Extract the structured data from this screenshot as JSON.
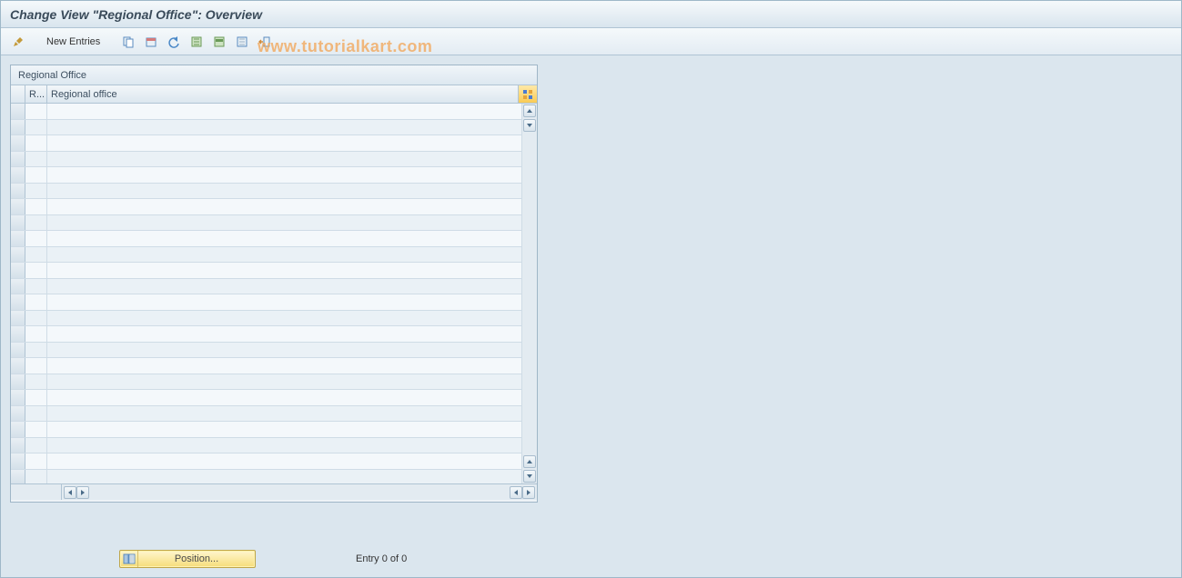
{
  "title": "Change View \"Regional Office\": Overview",
  "toolbar": {
    "new_entries_label": "New Entries"
  },
  "watermark": "www.tutorialkart.com",
  "panel": {
    "title": "Regional Office",
    "columns": {
      "code": "R...",
      "name": "Regional office"
    },
    "rows": []
  },
  "footer": {
    "position_label": "Position...",
    "entry_info": "Entry 0 of 0"
  }
}
